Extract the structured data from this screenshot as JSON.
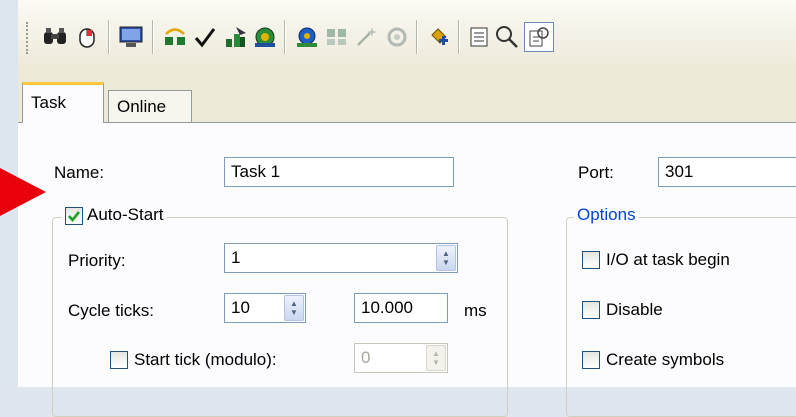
{
  "colors": {
    "accent_tab": "#ffc83c",
    "group_title_blue": "#0046d5",
    "checkmark_green": "#21a121",
    "pointer_red": "#e8000b"
  },
  "toolbar": {
    "icons": [
      "binoculars-icon",
      "mouse-icon",
      "monitor-icon",
      "network-icon",
      "check-icon",
      "build-icon",
      "activate-icon",
      "run-mode-icon",
      "scan-icon",
      "wand-icon",
      "restart-icon",
      "add-icon",
      "list-icon",
      "search-icon",
      "properties-icon"
    ]
  },
  "tabs": [
    {
      "label": "Task"
    },
    {
      "label": "Online"
    }
  ],
  "form": {
    "name_label": "Name:",
    "name_value": "Task 1",
    "port_label": "Port:",
    "port_value": "301",
    "auto_start_label": "Auto-Start",
    "auto_start_checked": true,
    "priority_label": "Priority:",
    "priority_value": "1",
    "cycle_ticks_label": "Cycle ticks:",
    "cycle_ticks_value": "10",
    "cycle_time_value": "10.000",
    "cycle_time_unit": "ms",
    "start_tick_label": "Start tick (modulo):",
    "start_tick_value": "0",
    "options_title": "Options",
    "io_at_task_begin_label": "I/O at task begin",
    "disable_label": "Disable",
    "create_symbols_label": "Create symbols"
  }
}
